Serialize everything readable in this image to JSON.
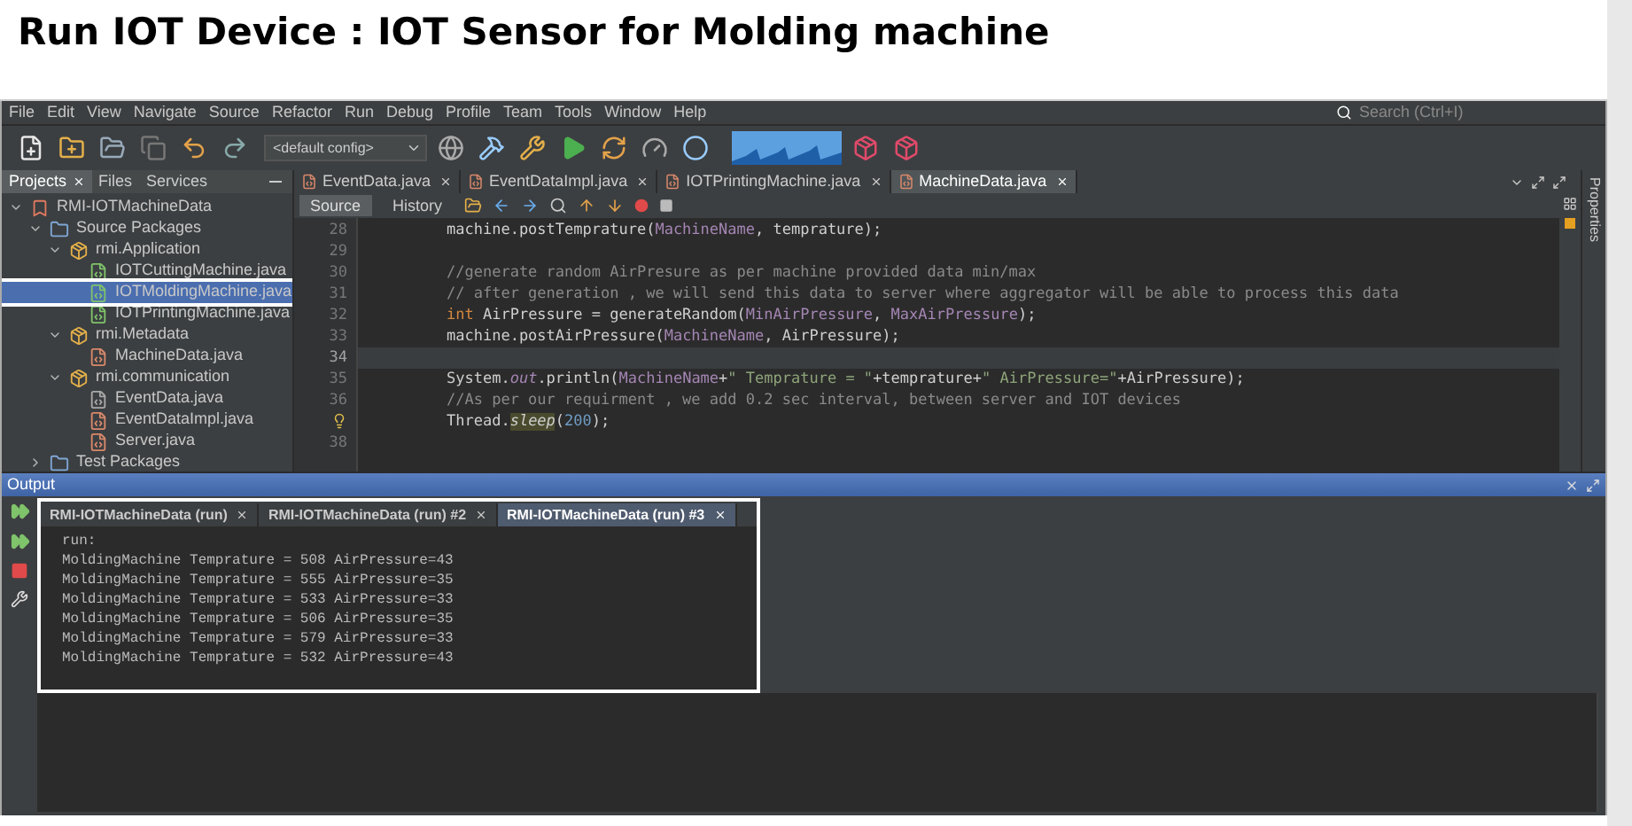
{
  "page_title": "Run IOT Device : IOT Sensor for Molding machine",
  "menu": [
    "File",
    "Edit",
    "View",
    "Navigate",
    "Source",
    "Refactor",
    "Run",
    "Debug",
    "Profile",
    "Team",
    "Tools",
    "Window",
    "Help"
  ],
  "search": {
    "placeholder": "Search (Ctrl+I)"
  },
  "toolbar": {
    "config": "<default config>"
  },
  "panel_tabs": [
    {
      "label": "Projects",
      "selected": true,
      "closable": true
    },
    {
      "label": "Files",
      "selected": false,
      "closable": false
    },
    {
      "label": "Services",
      "selected": false,
      "closable": false
    }
  ],
  "editor_tabs": [
    {
      "label": "EventData.java",
      "selected": false
    },
    {
      "label": "EventDataImpl.java",
      "selected": false
    },
    {
      "label": "IOTPrintingMachine.java",
      "selected": false
    },
    {
      "label": "MachineData.java",
      "selected": true
    }
  ],
  "tree": [
    {
      "label": "RMI-IOTMachineData",
      "kind": "project",
      "expanded": true,
      "selected": false,
      "children": [
        {
          "label": "Source Packages",
          "kind": "folder",
          "expanded": true,
          "selected": false,
          "children": [
            {
              "label": "rmi.Application",
              "kind": "package",
              "expanded": true,
              "selected": false,
              "children": [
                {
                  "label": "IOTCuttingMachine.java",
                  "kind": "main",
                  "selected": false
                },
                {
                  "label": "IOTMoldingMachine.java",
                  "kind": "main",
                  "selected": true
                },
                {
                  "label": "IOTPrintingMachine.java",
                  "kind": "main",
                  "selected": false
                }
              ]
            },
            {
              "label": "rmi.Metadata",
              "kind": "package",
              "expanded": true,
              "selected": false,
              "children": [
                {
                  "label": "MachineData.java",
                  "kind": "class",
                  "selected": false
                }
              ]
            },
            {
              "label": "rmi.communication",
              "kind": "package",
              "expanded": true,
              "selected": false,
              "children": [
                {
                  "label": "EventData.java",
                  "kind": "interface",
                  "selected": false
                },
                {
                  "label": "EventDataImpl.java",
                  "kind": "class",
                  "selected": false
                },
                {
                  "label": "Server.java",
                  "kind": "class",
                  "selected": false
                }
              ]
            }
          ]
        },
        {
          "label": "Test Packages",
          "kind": "folder",
          "expanded": false,
          "selected": false
        }
      ]
    }
  ],
  "editor_view_tabs": [
    {
      "label": "Source",
      "selected": true
    },
    {
      "label": "History",
      "selected": false
    }
  ],
  "code_lines": [
    {
      "kind": "number",
      "number": "28",
      "current": false,
      "tokens": [
        {
          "kind": "plain",
          "text": "machine.postTemprature("
        },
        {
          "kind": "field",
          "text": "MachineName"
        },
        {
          "kind": "plain",
          "text": ", temprature);"
        }
      ]
    },
    {
      "kind": "number",
      "number": "29",
      "current": false
    },
    {
      "kind": "number",
      "number": "30",
      "current": false,
      "tokens": [
        {
          "kind": "comment",
          "text": "//generate random AirPresure as per machine provided data min/max"
        }
      ]
    },
    {
      "kind": "number",
      "number": "31",
      "current": false,
      "tokens": [
        {
          "kind": "comment",
          "text": "// after generation , we will send this data to server where aggregator will be able to process this data"
        }
      ]
    },
    {
      "kind": "number",
      "number": "32",
      "current": false,
      "tokens": [
        {
          "kind": "keyword",
          "text": "int"
        },
        {
          "kind": "plain",
          "text": " AirPressure = generateRandom("
        },
        {
          "kind": "field",
          "text": "MinAirPressure"
        },
        {
          "kind": "plain",
          "text": ", "
        },
        {
          "kind": "field",
          "text": "MaxAirPressure"
        },
        {
          "kind": "plain",
          "text": ");"
        }
      ]
    },
    {
      "kind": "number",
      "number": "33",
      "current": false,
      "tokens": [
        {
          "kind": "plain",
          "text": "machine.postAirPressure("
        },
        {
          "kind": "field",
          "text": "MachineName"
        },
        {
          "kind": "plain",
          "text": ", AirPressure);"
        }
      ]
    },
    {
      "kind": "number",
      "number": "34",
      "current": true
    },
    {
      "kind": "number",
      "number": "35",
      "current": false,
      "tokens": [
        {
          "kind": "plain",
          "text": "System."
        },
        {
          "kind": "static",
          "text": "out"
        },
        {
          "kind": "plain",
          "text": ".println("
        },
        {
          "kind": "field",
          "text": "MachineName"
        },
        {
          "kind": "plain",
          "text": "+"
        },
        {
          "kind": "string",
          "text": "\" Temprature = \""
        },
        {
          "kind": "plain",
          "text": "+temprature+"
        },
        {
          "kind": "string",
          "text": "\" AirPressure=\""
        },
        {
          "kind": "plain",
          "text": "+AirPressure);"
        }
      ]
    },
    {
      "kind": "number",
      "number": "36",
      "current": false,
      "tokens": [
        {
          "kind": "comment",
          "text": "//As per our requirment , we add 0.2 sec interval, between server and IOT devices"
        }
      ]
    },
    {
      "kind": "hint",
      "current": false,
      "tokens": [
        {
          "kind": "plain",
          "text": "Thread."
        },
        {
          "kind": "mark",
          "text": "sleep"
        },
        {
          "kind": "plain",
          "text": "("
        },
        {
          "kind": "number",
          "text": "200"
        },
        {
          "kind": "plain",
          "text": ");"
        }
      ]
    },
    {
      "kind": "number",
      "number": "38",
      "current": false
    }
  ],
  "output": {
    "title": "Output",
    "tabs": [
      {
        "label": "RMI-IOTMachineData (run)",
        "selected": false
      },
      {
        "label": "RMI-IOTMachineData (run) #2",
        "selected": false
      },
      {
        "label": "RMI-IOTMachineData (run) #3",
        "selected": true
      }
    ],
    "lines": [
      "run:",
      "MoldingMachine Temprature = 508 AirPressure=43",
      "MoldingMachine Temprature = 555 AirPressure=35",
      "MoldingMachine Temprature = 533 AirPressure=33",
      "MoldingMachine Temprature = 506 AirPressure=35",
      "MoldingMachine Temprature = 579 AirPressure=33",
      "MoldingMachine Temprature = 532 AirPressure=43"
    ]
  },
  "side_panel": {
    "label": "Properties"
  }
}
